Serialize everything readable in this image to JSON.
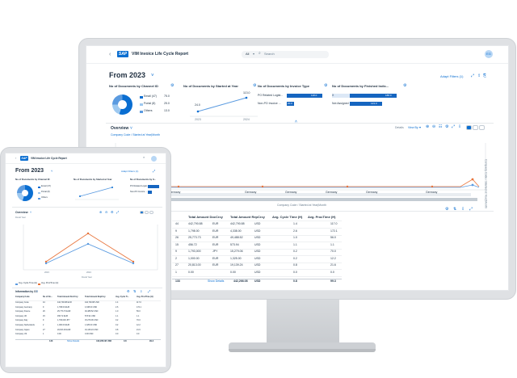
{
  "desktop": {
    "app_title": "VIM Invoice Life Cycle Report",
    "search_scope": "All",
    "search_placeholder": "Search",
    "avatar": "EG",
    "variant_title": "From 2023",
    "adapt_filters": "Adapt Filters (1)",
    "cards": [
      {
        "title": "No of Documents by Channel ID",
        "legend": [
          "Email (47)",
          "Portal (8)",
          "Others"
        ],
        "values": [
          "75.0",
          "25.0",
          "13.0"
        ]
      },
      {
        "title": "No of Documents by Started at Year",
        "points": [
          {
            "label": "2023",
            "value": "24.0"
          },
          {
            "label": "2024",
            "value": "113.0"
          }
        ]
      },
      {
        "title": "No of Documents by Invoice Type",
        "bars": [
          {
            "label": "PO Related Logist...",
            "value": "118.0"
          },
          {
            "label": "Non-PO Invoice ...",
            "value": "20.0"
          }
        ]
      },
      {
        "title": "No of Documents by Finished Indic...",
        "bars": [
          {
            "label": "X",
            "value": "188.0"
          },
          {
            "label": "Not Assigned",
            "value": "123.0"
          }
        ]
      }
    ],
    "overview_title": "Overview",
    "overview_subtitle": "Company Code / Started at Year|Month",
    "overview_controls": [
      "Details",
      "View By"
    ],
    "x_groups": [
      "Germany",
      "Germany",
      "Germany",
      "Germany",
      "Germany",
      "Germany",
      "Germany",
      "Germany",
      "Germany"
    ],
    "x_axis_title": "Company Code / Started at Year|Month",
    "table_columns": [
      "Total Amount DocCrcy",
      "Total Amount RepCrcy",
      "Avg. Cycle Time (H)",
      "Avg. ProcTime (H)"
    ],
    "table_rows": [
      {
        "count": "44",
        "amt_doc": "442,790.88",
        "cur_doc": "EUR",
        "amt_rep": "442,790.88",
        "cur_rep": "USD",
        "cycle": "1.4",
        "proc": "117.0"
      },
      {
        "count": "9",
        "amt_doc": "1,798.00",
        "cur_doc": "EUR",
        "amt_rep": "4,338.00",
        "cur_rep": "USD",
        "cycle": "2.6",
        "proc": "172.1"
      },
      {
        "count": "26",
        "amt_doc": "25,773.73",
        "cur_doc": "EUR",
        "amt_rep": "49,488.52",
        "cur_rep": "USD",
        "cycle": "1.0",
        "proc": "56.0"
      },
      {
        "count": "15",
        "amt_doc": "456.72",
        "cur_doc": "EUR",
        "amt_rep": "573.94",
        "cur_rep": "USD",
        "cycle": "1.1",
        "proc": "1.1"
      },
      {
        "count": "9",
        "amt_doc": "1,793,000",
        "cur_doc": "JPY",
        "amt_rep": "15,279.06",
        "cur_rep": "USD",
        "cycle": "0.2",
        "proc": "70.0"
      },
      {
        "count": "2",
        "amt_doc": "1,000.00",
        "cur_doc": "EUR",
        "amt_rep": "1,325.00",
        "cur_rep": "USD",
        "cycle": "0.2",
        "proc": "12.2"
      },
      {
        "count": "27",
        "amt_doc": "20,813.00",
        "cur_doc": "EUR",
        "amt_rep": "19,139.24",
        "cur_rep": "USD",
        "cycle": "0.8",
        "proc": "21.6"
      },
      {
        "count": "1",
        "amt_doc": "0.00",
        "cur_doc": "",
        "amt_rep": "0.00",
        "cur_rep": "USD",
        "cycle": "0.0",
        "proc": "0.0"
      }
    ],
    "table_footer": {
      "count": "133",
      "link": "Show Details",
      "amt_rep": "442,266.08",
      "cur_rep": "USD",
      "cycle": "0.8",
      "proc": "99.3"
    }
  },
  "tablet": {
    "app_title": "VIM Invoice Life Cycle Report",
    "variant_title": "From 2023",
    "adapt_filters": "Adapt Filters (1)",
    "cards": [
      "No of Documents by Channel ID",
      "No of Documents by Started at Year",
      "No of Documents by It..."
    ],
    "pie_legend": [
      "Email (47)",
      "Portal (8)",
      "Others"
    ],
    "bars": [
      "PO Related Logist...",
      "Non-PO Invoice ..."
    ],
    "overview_title": "Overview",
    "chart_subtitle": "Fiscal Year",
    "x_labels": [
      "2023",
      "2024"
    ],
    "x_axis_title": "Fiscal Year",
    "legend": [
      "Avg. Cycle Time (H)",
      "Avg. ProcTime (H)"
    ],
    "table_title": "Information by CC",
    "table_columns": [
      "Company Code",
      "No of Do...",
      "Total Amount DocCrcy",
      "Total Amount RepCrcy",
      "Avg. Cycle Ti...",
      "Avg. ProcTime (H)"
    ],
    "table_rows": [
      [
        "Company Code",
        "44",
        "442,790.88 EUR",
        "442,790.88 USD",
        "1.4",
        "117.0"
      ],
      [
        "Company Germany",
        "9",
        "1,798.00 EUR",
        "4,338.00 USD",
        "2.6",
        "172.1"
      ],
      [
        "Company France",
        "26",
        "25,773.73 EUR",
        "49,488.52 USD",
        "1.0",
        "56.0"
      ],
      [
        "Company UK",
        "15",
        "456.72 EUR",
        "573.94 USD",
        "1.1",
        "1.1"
      ],
      [
        "Company Italy",
        "9",
        "1,793,000 JPY",
        "15,279.06 USD",
        "0.2",
        "70.0"
      ],
      [
        "Company Netherlands",
        "2",
        "1,000.00 EUR",
        "1,325.00 USD",
        "0.2",
        "12.2"
      ],
      [
        "Company Japan",
        "27",
        "20,813.00 EUR",
        "19,139.24 USD",
        "0.8",
        "21.6"
      ],
      [
        "Company US",
        "1",
        "0.00",
        "0.00 USD",
        "0.0",
        "0.0"
      ]
    ],
    "table_footer": [
      "133",
      "Show Details",
      "442,266.08 USD",
      "0.8",
      "99.3"
    ]
  },
  "colors": {
    "accent": "#0a6ed1",
    "orange": "#e8743b",
    "lightblue": "#5b9be0",
    "pie_dark": "#0a6ed1",
    "pie_light": "#9ec9f0"
  }
}
